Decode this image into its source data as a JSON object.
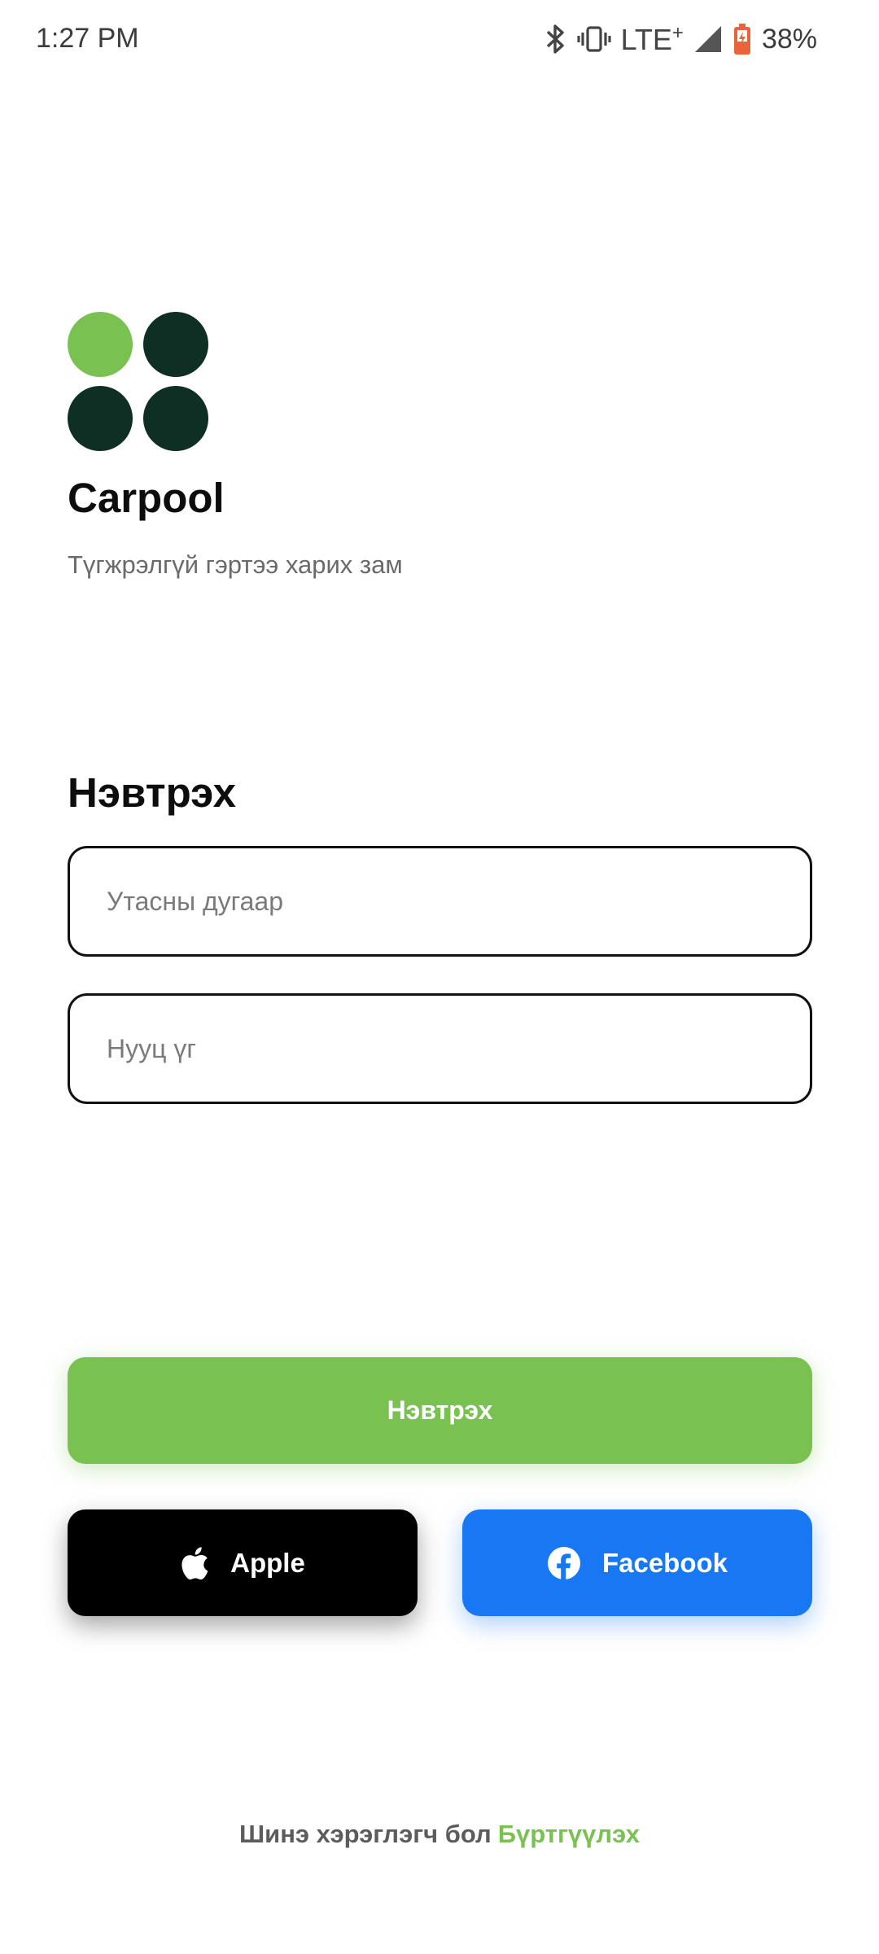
{
  "status_bar": {
    "time": "1:27 PM",
    "network": "LTE",
    "network_suffix": "+",
    "battery_percent": "38%",
    "icons": [
      "bluetooth-icon",
      "vibrate-icon",
      "signal-icon",
      "battery-icon"
    ]
  },
  "app": {
    "name": "Carpool",
    "tagline": "Түгжрэлгүй гэртээ харих зам",
    "logo_colors": {
      "accent": "#79c151",
      "dark": "#0f2e24"
    }
  },
  "login": {
    "heading": "Нэвтрэх",
    "phone_placeholder": "Утасны дугаар",
    "phone_value": "",
    "password_placeholder": "Нууц үг",
    "password_value": "",
    "submit_label": "Нэвтрэх"
  },
  "social": {
    "apple_label": "Apple",
    "apple_icon": "apple-icon",
    "facebook_label": "Facebook",
    "facebook_icon": "facebook-icon"
  },
  "signup": {
    "prompt": "Шинэ хэрэглэгч бол",
    "link": "Бүртгүүлэх"
  },
  "colors": {
    "primary_green": "#79c151",
    "apple_black": "#000000",
    "facebook_blue": "#1877f2",
    "link_green": "#79c151"
  }
}
